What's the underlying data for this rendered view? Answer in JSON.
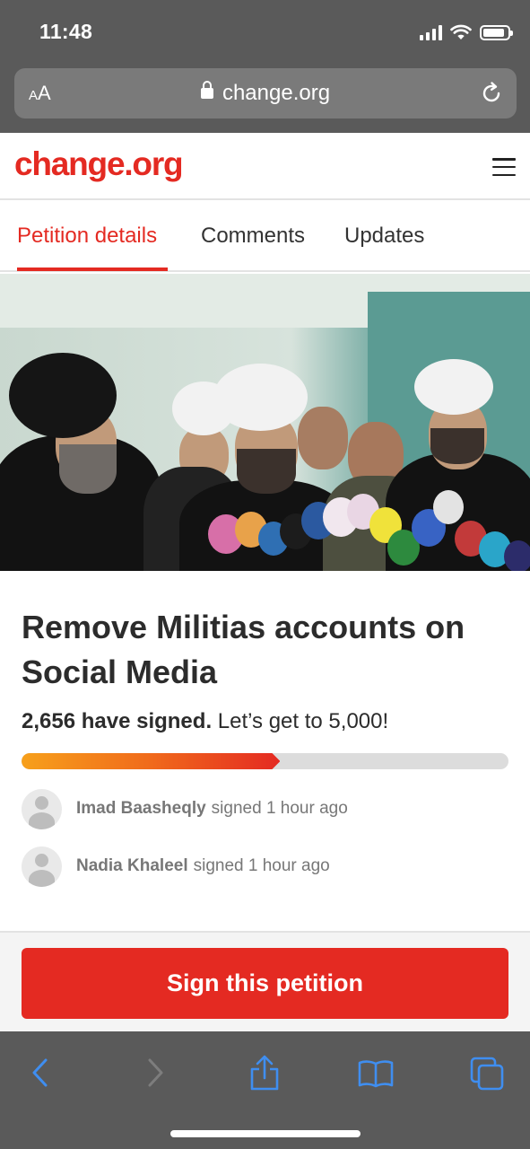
{
  "status_bar": {
    "time": "11:48",
    "icons": [
      "signal-icon",
      "wifi-icon",
      "battery-icon"
    ]
  },
  "browser": {
    "text_size_label_small": "A",
    "text_size_label_large": "A",
    "url": "change.org",
    "icons": [
      "lock-icon",
      "reload-icon"
    ]
  },
  "site": {
    "logo": "change.org",
    "menu_icon": "hamburger-menu-icon",
    "brand_color": "#e42a22"
  },
  "tabs": [
    {
      "label": "Petition details",
      "active": true
    },
    {
      "label": "Comments",
      "active": false
    },
    {
      "label": "Updates",
      "active": false
    }
  ],
  "petition": {
    "title": "Remove Militias accounts on Social Media",
    "signed_count": "2,656 have signed.",
    "goal_text": " Let’s get to 5,000!",
    "progress_fraction": 0.5312,
    "signers": [
      {
        "name": "Imad Baasheqly",
        "action": "signed 1 hour ago"
      },
      {
        "name": "Nadia Khaleel",
        "action": "signed 1 hour ago"
      }
    ],
    "sign_button": "Sign this petition"
  },
  "toolbar": {
    "icons": [
      "back-icon",
      "forward-icon",
      "share-icon",
      "bookmarks-icon",
      "tabs-icon"
    ],
    "icon_color": "#3f8ef0"
  }
}
